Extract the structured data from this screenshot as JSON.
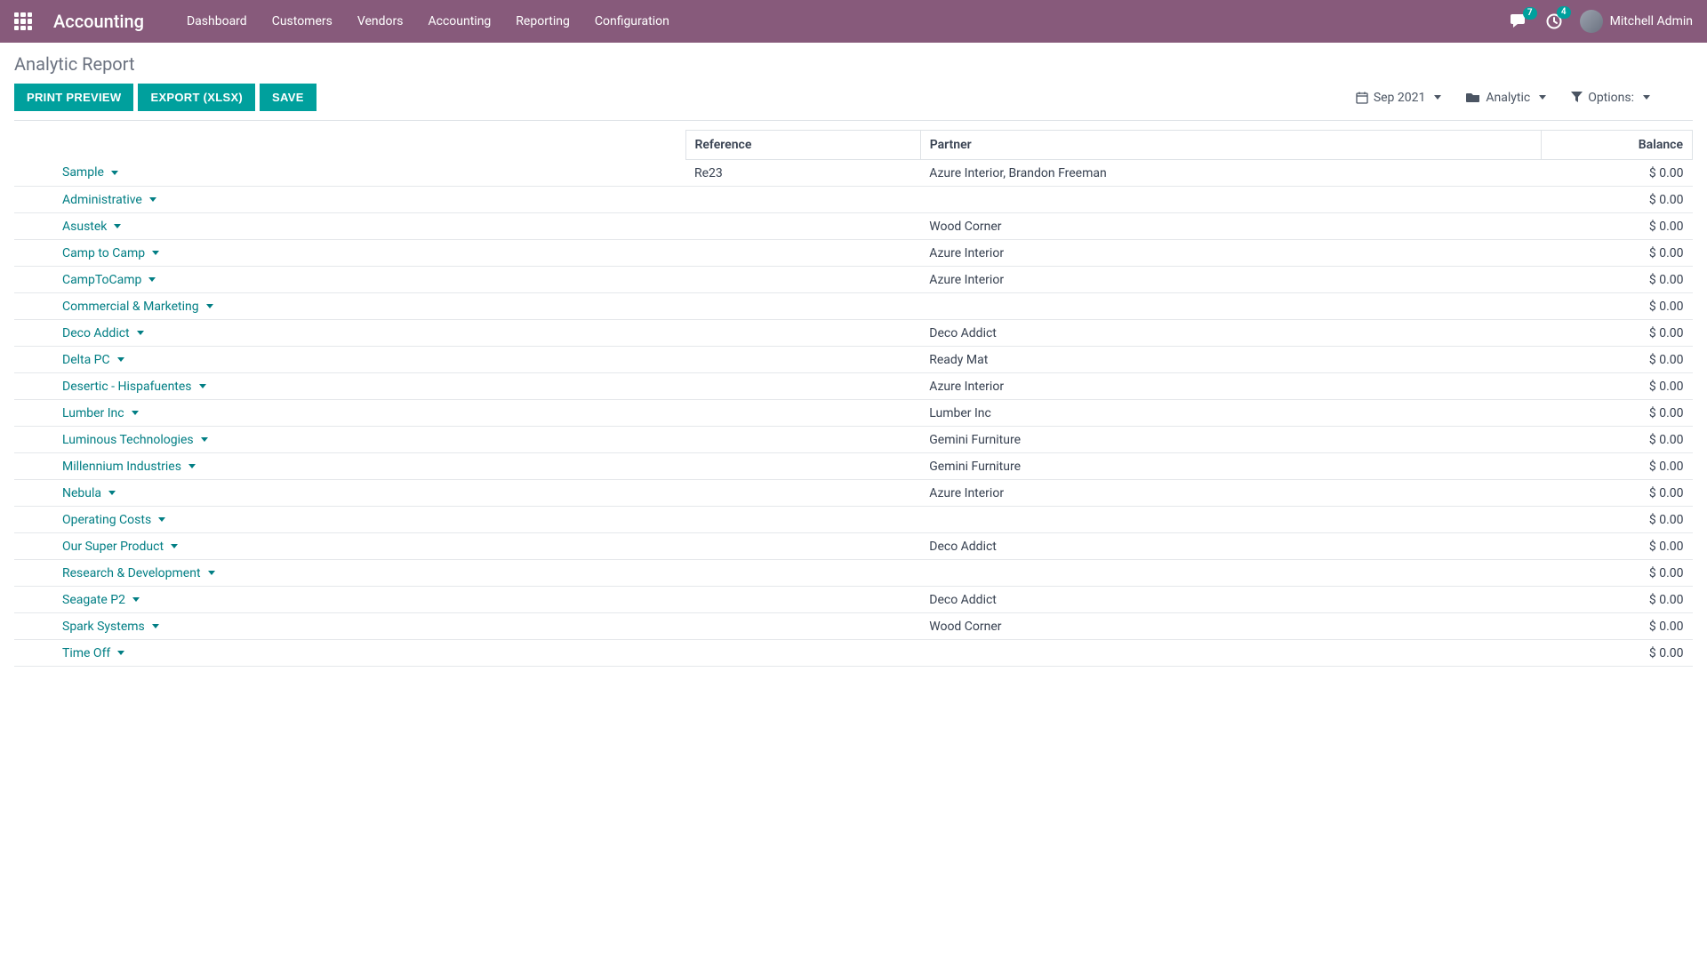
{
  "brand": "Accounting",
  "nav": [
    "Dashboard",
    "Customers",
    "Vendors",
    "Accounting",
    "Reporting",
    "Configuration"
  ],
  "badges": {
    "messages": "7",
    "activities": "4"
  },
  "user": "Mitchell Admin",
  "page_title": "Analytic Report",
  "buttons": {
    "print": "PRINT PREVIEW",
    "export": "EXPORT (XLSX)",
    "save": "SAVE"
  },
  "filters": {
    "period": "Sep 2021",
    "analytic": "Analytic",
    "options": "Options:"
  },
  "columns": {
    "reference": "Reference",
    "partner": "Partner",
    "balance": "Balance"
  },
  "rows": [
    {
      "name": "Sample",
      "reference": "Re23",
      "partner": "Azure Interior, Brandon Freeman",
      "balance": "$ 0.00"
    },
    {
      "name": "Administrative",
      "reference": "",
      "partner": "",
      "balance": "$ 0.00"
    },
    {
      "name": "Asustek",
      "reference": "",
      "partner": "Wood Corner",
      "balance": "$ 0.00"
    },
    {
      "name": "Camp to Camp",
      "reference": "",
      "partner": "Azure Interior",
      "balance": "$ 0.00"
    },
    {
      "name": "CampToCamp",
      "reference": "",
      "partner": "Azure Interior",
      "balance": "$ 0.00"
    },
    {
      "name": "Commercial & Marketing",
      "reference": "",
      "partner": "",
      "balance": "$ 0.00"
    },
    {
      "name": "Deco Addict",
      "reference": "",
      "partner": "Deco Addict",
      "balance": "$ 0.00"
    },
    {
      "name": "Delta PC",
      "reference": "",
      "partner": "Ready Mat",
      "balance": "$ 0.00"
    },
    {
      "name": "Desertic - Hispafuentes",
      "reference": "",
      "partner": "Azure Interior",
      "balance": "$ 0.00"
    },
    {
      "name": "Lumber Inc",
      "reference": "",
      "partner": "Lumber Inc",
      "balance": "$ 0.00"
    },
    {
      "name": "Luminous Technologies",
      "reference": "",
      "partner": "Gemini Furniture",
      "balance": "$ 0.00"
    },
    {
      "name": "Millennium Industries",
      "reference": "",
      "partner": "Gemini Furniture",
      "balance": "$ 0.00"
    },
    {
      "name": "Nebula",
      "reference": "",
      "partner": "Azure Interior",
      "balance": "$ 0.00"
    },
    {
      "name": "Operating Costs",
      "reference": "",
      "partner": "",
      "balance": "$ 0.00"
    },
    {
      "name": "Our Super Product",
      "reference": "",
      "partner": "Deco Addict",
      "balance": "$ 0.00"
    },
    {
      "name": "Research & Development",
      "reference": "",
      "partner": "",
      "balance": "$ 0.00"
    },
    {
      "name": "Seagate P2",
      "reference": "",
      "partner": "Deco Addict",
      "balance": "$ 0.00"
    },
    {
      "name": "Spark Systems",
      "reference": "",
      "partner": "Wood Corner",
      "balance": "$ 0.00"
    },
    {
      "name": "Time Off",
      "reference": "",
      "partner": "",
      "balance": "$ 0.00"
    }
  ]
}
